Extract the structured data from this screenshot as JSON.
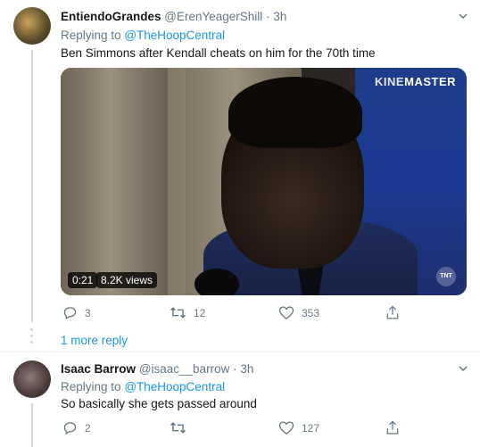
{
  "tweet1": {
    "name": "EntiendoGrandes",
    "handle": "@ErenYeagerShill",
    "separator": "·",
    "time": "3h",
    "replying_label": "Replying to",
    "replying_to": "@TheHoopCentral",
    "text": "Ben Simmons after Kendall cheats on him for the 70th time",
    "media": {
      "watermark_prefix": "KINE",
      "watermark_suffix": "MASTER",
      "duration": "0:21",
      "views": "8.2K views",
      "network_logo": "TNT"
    },
    "actions": {
      "replies": "3",
      "retweets": "12",
      "likes": "353"
    }
  },
  "more_replies": "1 more reply",
  "tweet2": {
    "name": "Isaac Barrow",
    "handle": "@isaac__barrow",
    "separator": "·",
    "time": "3h",
    "replying_label": "Replying to",
    "replying_to": "@TheHoopCentral",
    "text": "So basically she gets passed around",
    "actions": {
      "replies": "2",
      "retweets": "",
      "likes": "127"
    }
  },
  "colors": {
    "link": "#1b95e0",
    "secondary_text": "#657786",
    "primary_text": "#14171a"
  },
  "icons": {
    "reply": "reply-icon",
    "retweet": "retweet-icon",
    "like": "heart-icon",
    "share": "share-icon",
    "more": "chevron-down-icon"
  }
}
